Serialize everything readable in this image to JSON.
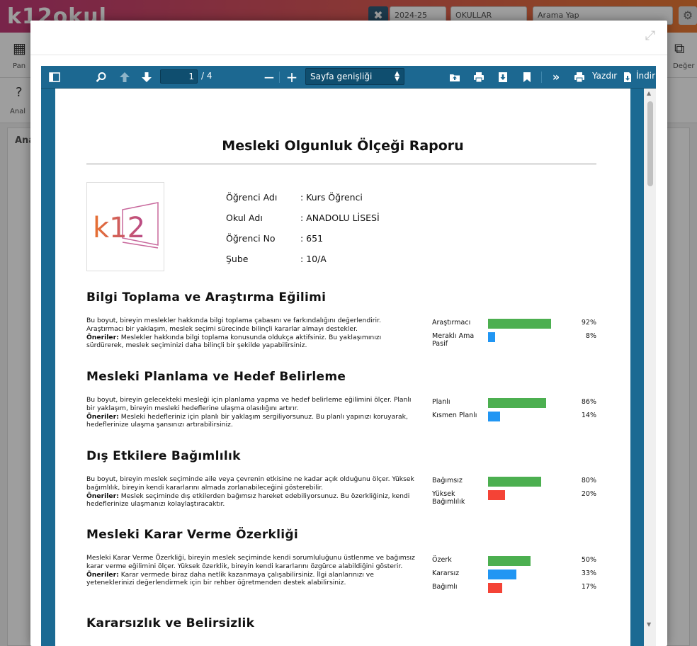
{
  "background": {
    "logo": "k12okul",
    "date_select": "2024-25",
    "school_select": "OKULLAR",
    "search_placeholder": "Arama Yap",
    "toolbar_label_1": "Pan",
    "toolbar_label_2": "Anal",
    "toolbar_label_right": "Değer",
    "panel_tab": "Ana"
  },
  "viewer": {
    "page_current": "1",
    "page_total": "/ 4",
    "zoom": "Sayfa genişliği",
    "print_label": "Yazdır",
    "download_label": "İndir",
    "icons": [
      "sidebar-toggle-icon",
      "search-icon",
      "arrow-up-icon",
      "arrow-down-icon",
      "zoom-out-icon",
      "zoom-in-icon",
      "open-file-icon",
      "print-icon",
      "save-icon",
      "bookmark-icon",
      "more-tools-icon",
      "print-icon",
      "download-icon"
    ]
  },
  "report": {
    "title": "Mesleki Olgunluk Ölçeği Raporu",
    "logo_text": "k12",
    "info": [
      {
        "key": "Öğrenci Adı",
        "value": ": Kurs Öğrenci"
      },
      {
        "key": "Okul Adı",
        "value": ": ANADOLU LİSESİ"
      },
      {
        "key": "Öğrenci No",
        "value": ": 651"
      },
      {
        "key": "Şube",
        "value": ": 10/A"
      }
    ],
    "sections": [
      {
        "title": "Bilgi Toplama ve Araştırma Eğilimi",
        "desc": "Bu boyut, bireyin meslekler hakkında bilgi toplama çabasını ve farkındalığını değerlendirir. Araştırmacı bir yaklaşım, meslek seçimi sürecinde bilinçli kararlar almayı destekler.",
        "suggestion_label": "Öneriler:",
        "suggestion": " Meslekler hakkında bilgi toplama konusunda oldukça aktifsiniz. Bu yaklaşımınızı sürdürerek, meslek seçiminizi daha bilinçli bir şekilde yapabilirsiniz.",
        "bars": [
          {
            "label": "Araştırmacı",
            "value": 92,
            "pct": "92%",
            "color": "#4caf50"
          },
          {
            "label": "Meraklı Ama Pasif",
            "value": 8,
            "pct": "8%",
            "color": "#2196f3"
          }
        ]
      },
      {
        "title": "Mesleki Planlama ve Hedef Belirleme",
        "desc": "Bu boyut, bireyin gelecekteki mesleği için planlama yapma ve hedef belirleme eğilimini ölçer. Planlı bir yaklaşım, bireyin mesleki hedeflerine ulaşma olasılığını artırır.",
        "suggestion_label": "Öneriler:",
        "suggestion": " Mesleki hedefleriniz için planlı bir yaklaşım sergiliyorsunuz. Bu planlı yapınızı koruyarak, hedeflerinize ulaşma şansınızı artırabilirsiniz.",
        "bars": [
          {
            "label": "Planlı",
            "value": 86,
            "pct": "86%",
            "color": "#4caf50"
          },
          {
            "label": "Kısmen Planlı",
            "value": 14,
            "pct": "14%",
            "color": "#2196f3"
          }
        ]
      },
      {
        "title": "Dış Etkilere Bağımlılık",
        "desc": "Bu boyut, bireyin meslek seçiminde aile veya çevrenin etkisine ne kadar açık olduğunu ölçer. Yüksek bağımlılık, bireyin kendi kararlarını almada zorlanabileceğini gösterebilir.",
        "suggestion_label": "Öneriler:",
        "suggestion": " Meslek seçiminde dış etkilerden bağımsız hareket edebiliyorsunuz. Bu özerkliğiniz, kendi hedeflerinize ulaşmanızı kolaylaştıracaktır.",
        "bars": [
          {
            "label": "Bağımsız",
            "value": 80,
            "pct": "80%",
            "color": "#4caf50"
          },
          {
            "label": "Yüksek Bağımlılık",
            "value": 20,
            "pct": "20%",
            "color": "#f44336"
          }
        ]
      },
      {
        "title": "Mesleki Karar Verme Özerkliği",
        "desc": "Mesleki Karar Verme Özerkliği, bireyin meslek seçiminde kendi sorumluluğunu üstlenme ve bağımsız karar verme eğilimini ölçer. Yüksek özerklik, bireyin kendi kararlarını özgürce alabildiğini gösterir.",
        "suggestion_label": "Öneriler:",
        "suggestion": " Karar vermede biraz daha netlik kazanmaya çalışabilirsiniz. İlgi alanlarınızı ve yeteneklerinizi değerlendirmek için bir rehber öğretmenden destek alabilirsiniz.",
        "bars": [
          {
            "label": "Özerk",
            "value": 50,
            "pct": "50%",
            "color": "#4caf50"
          },
          {
            "label": "Kararsız",
            "value": 33,
            "pct": "33%",
            "color": "#2196f3"
          },
          {
            "label": "Bağımlı",
            "value": 17,
            "pct": "17%",
            "color": "#f44336"
          }
        ]
      },
      {
        "title": "Kararsızlık ve Belirsizlik"
      }
    ]
  }
}
